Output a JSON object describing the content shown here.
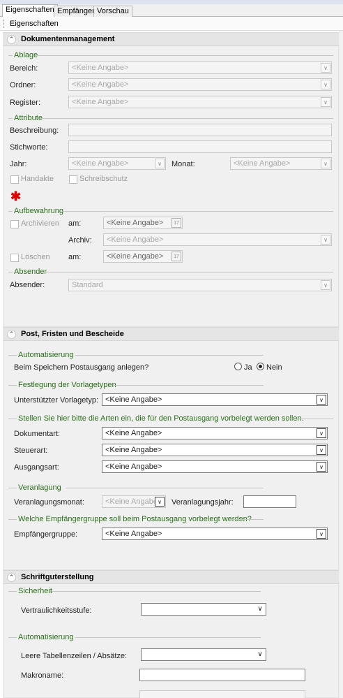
{
  "tabs": [
    {
      "label": "Eigenschaften"
    },
    {
      "label": "Empfänger"
    },
    {
      "label": "Vorschau"
    }
  ],
  "toolbar": {
    "label": "Eigenschaften"
  },
  "placeholder": "<Keine Angabe>",
  "placeholder_truncated": "<Keine Angabe>",
  "sections": {
    "dokument": {
      "title": "Dokumentenmanagement",
      "ablage": {
        "group": "Ablage",
        "bereich": "Bereich:",
        "ordner": "Ordner:",
        "register": "Register:"
      },
      "attribute": {
        "group": "Attribute",
        "beschreibung": "Beschreibung:",
        "stichworte": "Stichworte:",
        "jahr": "Jahr:",
        "monat": "Monat:",
        "handakte": "Handakte",
        "schreibschutz": "Schreibschutz"
      },
      "aufbewahrung": {
        "group": "Aufbewahrung",
        "archivieren": "Archivieren",
        "am1": "am:",
        "archiv": "Archiv:",
        "loeschen": "Löschen",
        "am2": "am:"
      },
      "absender": {
        "group": "Absender",
        "label": "Absender:",
        "value": "Standard"
      }
    },
    "post": {
      "title": "Post, Fristen und Bescheide",
      "auto": {
        "group": "Automatisierung",
        "question": "Beim Speichern Postausgang anlegen?",
        "ja": "Ja",
        "nein": "Nein"
      },
      "vorlage": {
        "group": "Festlegung der Vorlagetypen",
        "label": "Unterstützter Vorlagetyp:"
      },
      "arten": {
        "group": "Stellen Sie hier bitte die Arten ein, die für den Postausgang vorbelegt werden sollen.",
        "dokumentart": "Dokumentart:",
        "steuerart": "Steuerart:",
        "ausgangsart": "Ausgangsart:"
      },
      "veranlagung": {
        "group": "Veranlagung",
        "monat": "Veranlagungsmonat:",
        "jahr": "Veranlagungsjahr:"
      },
      "empf": {
        "group": "Welche Empfängergruppe soll beim Postausgang vorbelegt werden?",
        "label": "Empfängergruppe:"
      }
    },
    "schrift": {
      "title": "Schriftguterstellung",
      "sicherheit": {
        "group": "Sicherheit",
        "label": "Vertraulichkeitsstufe:"
      },
      "auto": {
        "group": "Automatisierung",
        "leere": "Leere Tabellenzeilen / Absätze:",
        "makro": "Makroname:"
      }
    }
  },
  "colors": {
    "group_label": "#2a6e1a",
    "required_mark": "#e00000"
  }
}
